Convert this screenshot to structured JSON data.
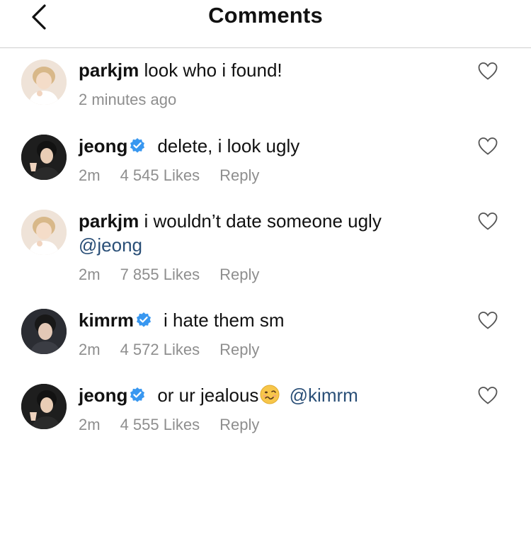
{
  "header": {
    "title": "Comments",
    "back_icon": "chevron-left-icon"
  },
  "comments": [
    {
      "username": "parkjm",
      "text": "look who i found!",
      "time": "2 minutes ago",
      "verified": false
    },
    {
      "username": "jeong",
      "text": "delete, i look ugly",
      "time": "2m",
      "likes": "4 545 Likes",
      "reply": "Reply",
      "verified": true
    },
    {
      "username": "parkjm",
      "text": "i wouldn’t date someone ugly",
      "mention": "@jeong",
      "time": "2m",
      "likes": "7 855 Likes",
      "reply": "Reply",
      "verified": false
    },
    {
      "username": "kimrm",
      "text": "i hate them sm",
      "time": "2m",
      "likes": "4 572 Likes",
      "reply": "Reply",
      "verified": true
    },
    {
      "username": "jeong",
      "text": "or ur jealous",
      "emoji": "woozy-face-emoji",
      "mention": "@kimrm",
      "time": "2m",
      "likes": "4 555 Likes",
      "reply": "Reply",
      "verified": true
    }
  ],
  "colors": {
    "mention": "#2a4f77",
    "meta": "#8e8e8e",
    "verified": "#3897f0",
    "divider": "#cfcfcf"
  }
}
